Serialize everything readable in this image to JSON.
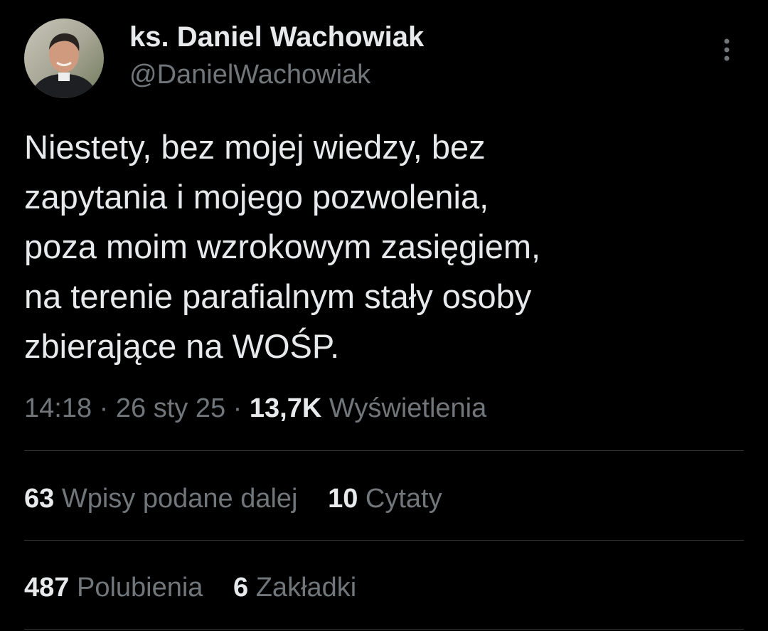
{
  "author": {
    "display_name": "ks. Daniel Wachowiak",
    "handle": "@DanielWachowiak",
    "avatar_icon": "avatar-photo"
  },
  "more_icon": "more-vertical-icon",
  "tweet": {
    "lines": [
      "Niestety, bez mojej wiedzy, bez",
      "zapytania i mojego pozwolenia,",
      "poza moim wzrokowym zasięgiem,",
      "na terenie parafialnym stały osoby",
      "zbierające na WOŚP."
    ]
  },
  "meta": {
    "time": "14:18",
    "separator": "·",
    "date": "26 sty 25",
    "views_count": "13,7K",
    "views_label": "Wyświetlenia"
  },
  "stats": {
    "reposts_count": "63",
    "reposts_label": "Wpisy podane dalej",
    "quotes_count": "10",
    "quotes_label": "Cytaty",
    "likes_count": "487",
    "likes_label": "Polubienia",
    "bookmarks_count": "6",
    "bookmarks_label": "Zakładki"
  },
  "colors": {
    "background": "#000000",
    "text_primary": "#e7e9ea",
    "text_secondary": "#71767b",
    "divider": "#2f3336"
  }
}
